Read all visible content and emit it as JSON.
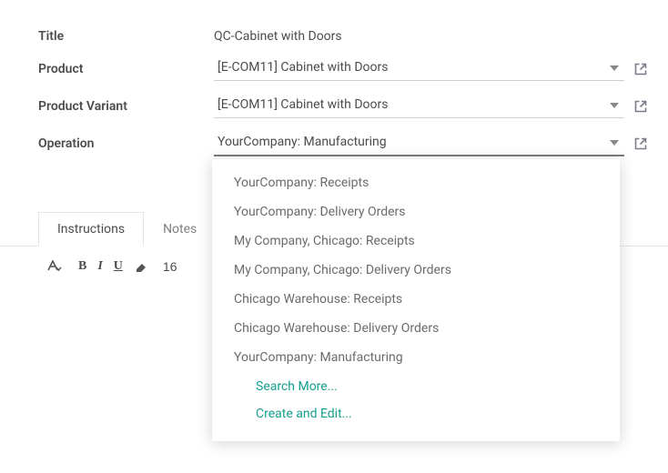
{
  "fields": {
    "title": {
      "label": "Title",
      "value": "QC-Cabinet with Doors"
    },
    "product": {
      "label": "Product",
      "value": "[E-COM11] Cabinet with Doors"
    },
    "product_variant": {
      "label": "Product Variant",
      "value": "[E-COM11] Cabinet with Doors"
    },
    "operation": {
      "label": "Operation",
      "value": "YourCompany: Manufacturing"
    }
  },
  "tabs": {
    "instructions": "Instructions",
    "notes": "Notes"
  },
  "toolbar": {
    "size_hint": "16"
  },
  "dropdown": {
    "options": [
      "YourCompany: Receipts",
      "YourCompany: Delivery Orders",
      "My Company, Chicago: Receipts",
      "My Company, Chicago: Delivery Orders",
      "Chicago Warehouse: Receipts",
      "Chicago Warehouse: Delivery Orders",
      "YourCompany: Manufacturing"
    ],
    "search_more": "Search More...",
    "create_edit": "Create and Edit..."
  }
}
